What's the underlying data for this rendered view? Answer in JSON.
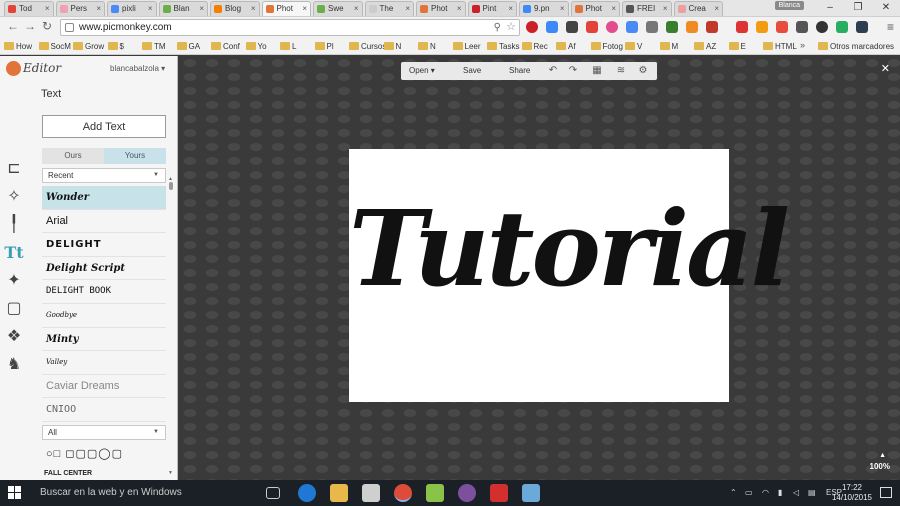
{
  "browser": {
    "tabs": [
      {
        "label": "Tod",
        "color": "#e2443a"
      },
      {
        "label": "Pers",
        "color": "#f3a0b5"
      },
      {
        "label": "pixli",
        "color": "#4a8af4"
      },
      {
        "label": "Blan",
        "color": "#6cae4a"
      },
      {
        "label": "Blog",
        "color": "#f57d00"
      },
      {
        "label": "Phot",
        "color": "#e1743a",
        "active": true
      },
      {
        "label": "Swe",
        "color": "#6cae4a"
      },
      {
        "label": "The",
        "color": "#cccccc"
      },
      {
        "label": "Phot",
        "color": "#e1743a"
      },
      {
        "label": "Pint",
        "color": "#cb2027"
      },
      {
        "label": "9.pn",
        "color": "#3d8af7"
      },
      {
        "label": "Phot",
        "color": "#e1743a"
      },
      {
        "label": "FREI",
        "color": "#555555"
      },
      {
        "label": "Crea",
        "color": "#e8a0a0"
      }
    ],
    "user_chip": "Blanca",
    "window_controls": {
      "minimize": "–",
      "maximize": "❐",
      "close": "✕"
    },
    "url": "www.picmonkey.com",
    "bookmarks": [
      "How",
      "SocM",
      "Grow",
      "$",
      "TM",
      "GA",
      "Conf",
      "Yo",
      "L",
      "Pl",
      "Cursos",
      "N",
      "N",
      "Leer",
      "Tasks",
      "Rec",
      "Af",
      "Fotog",
      "V",
      "M",
      "AZ",
      "E",
      "HTML"
    ],
    "bookmarks_more": "»",
    "other_bookmarks": "Otros marcadores"
  },
  "editor": {
    "logo": "Editor",
    "username": "blancabalzola",
    "panel_title": "Text",
    "add_text_button": "Add Text",
    "tab_ours": "Ours",
    "tab_yours": "Yours",
    "filter_select": "Recent",
    "fonts": [
      {
        "name": "Wonder",
        "style": "script",
        "selected": true
      },
      {
        "name": "Arial",
        "style": "sans"
      },
      {
        "name": "DELIGHT",
        "style": "bold-caps"
      },
      {
        "name": "Delight Script",
        "style": "script"
      },
      {
        "name": "DELIGHT BOOK",
        "style": "caps"
      },
      {
        "name": "Goodbye",
        "style": "tiny-script"
      },
      {
        "name": "Minty",
        "style": "script"
      },
      {
        "name": "Valley",
        "style": "tiny-script"
      },
      {
        "name": "Caviar Dreams",
        "style": "thin"
      },
      {
        "name": "CNIOO",
        "style": "thin-caps"
      }
    ],
    "category_select": "All",
    "cut_off_label": "FALL CENTER",
    "commands": {
      "open": "Open",
      "save": "Save",
      "share": "Share"
    },
    "canvas_text": "Tutorial",
    "zoom": "100%"
  },
  "taskbar": {
    "search_placeholder": "Buscar en la web y en Windows",
    "language": "ESP",
    "time": "17:22",
    "date": "14/10/2015"
  },
  "colors": {
    "picmonkey_orange": "#e1743a",
    "selection_blue": "#c8e2ea",
    "active_tool": "#3a9fb5",
    "canvas_bg": "#3a3a3a",
    "taskbar": "#1b1f26"
  }
}
